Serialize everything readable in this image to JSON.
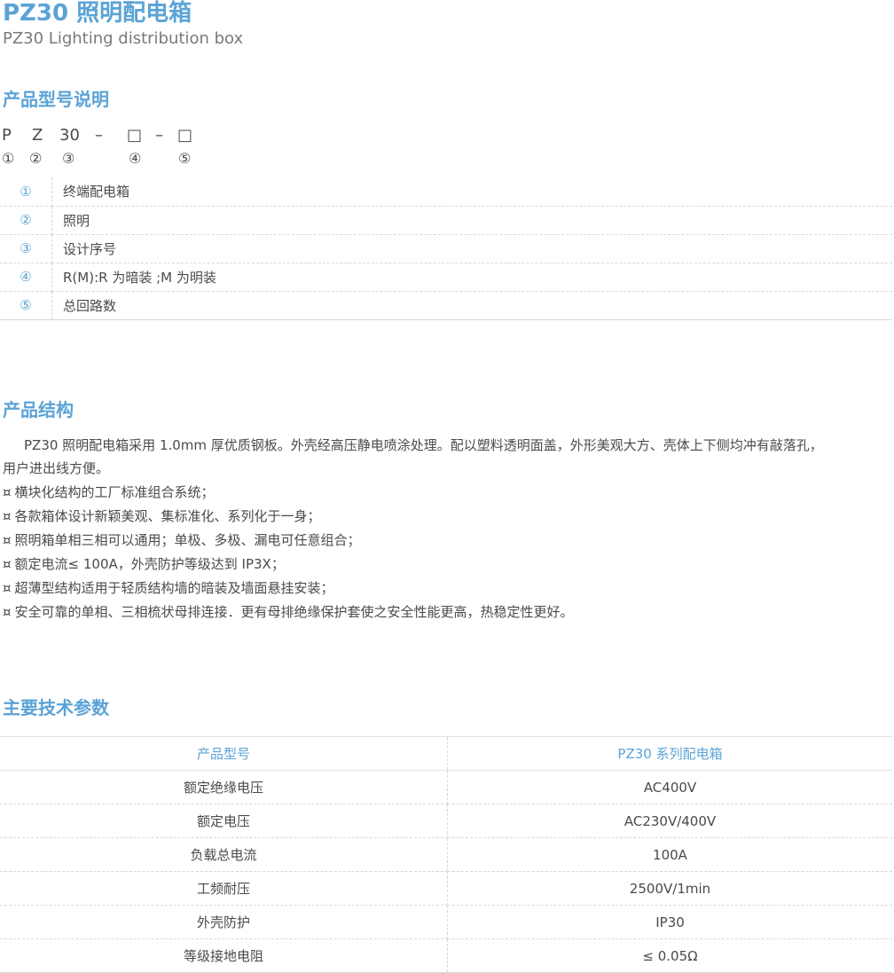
{
  "header": {
    "title": "PZ30 照明配电箱",
    "subtitle": "PZ30 Lighting distribution box"
  },
  "model_section": {
    "heading": "产品型号说明",
    "code": {
      "p1": "P",
      "p2": "Z",
      "p3": "30",
      "dash1": "–",
      "box1": "□",
      "dash2": "–",
      "box2": "□"
    },
    "circles": [
      "①",
      "②",
      "③",
      "④",
      "⑤"
    ],
    "legend": [
      {
        "num": "①",
        "desc": "终端配电箱"
      },
      {
        "num": "②",
        "desc": "照明"
      },
      {
        "num": "③",
        "desc": "设计序号"
      },
      {
        "num": "④",
        "desc": "R(M):R 为暗装 ;M 为明装"
      },
      {
        "num": "⑤",
        "desc": "总回路数"
      }
    ]
  },
  "structure_section": {
    "heading": "产品结构",
    "paragraph_line1": "PZ30 照明配电箱采用 1.0mm 厚优质钢板。外壳经高压静电喷涂处理。配以塑料透明面盖，外形美观大方、壳体上下侧均冲有敲落孔，",
    "paragraph_line2": "用户进出线方便。",
    "bullet_mark": "¤",
    "bullets": [
      "横块化结构的工厂标准组合系统；",
      "各款箱体设计新颖美观、集标准化、系列化于一身；",
      "照明箱单相三相可以通用；单极、多极、漏电可任意组合；",
      "额定电流≤ 100A，外壳防护等级达到 IP3X；",
      "超薄型结构适用于轻质结构墙的暗装及墙面悬挂安装；",
      "安全可靠的单相、三相梳状母排连接．更有母排绝缘保护套使之安全性能更高，热稳定性更好。"
    ]
  },
  "params_section": {
    "heading": "主要技术参数",
    "table_header": {
      "col1": "产品型号",
      "col2": "PZ30 系列配电箱"
    },
    "rows": [
      {
        "name": "额定绝缘电压",
        "value": "AC400V"
      },
      {
        "name": "额定电压",
        "value": "AC230V/400V"
      },
      {
        "name": "负载总电流",
        "value": "100A"
      },
      {
        "name": "工频耐压",
        "value": "2500V/1min"
      },
      {
        "name": "外壳防护",
        "value": "IP30"
      },
      {
        "name": "等级接地电阻",
        "value": "≤ 0.05Ω"
      }
    ]
  }
}
